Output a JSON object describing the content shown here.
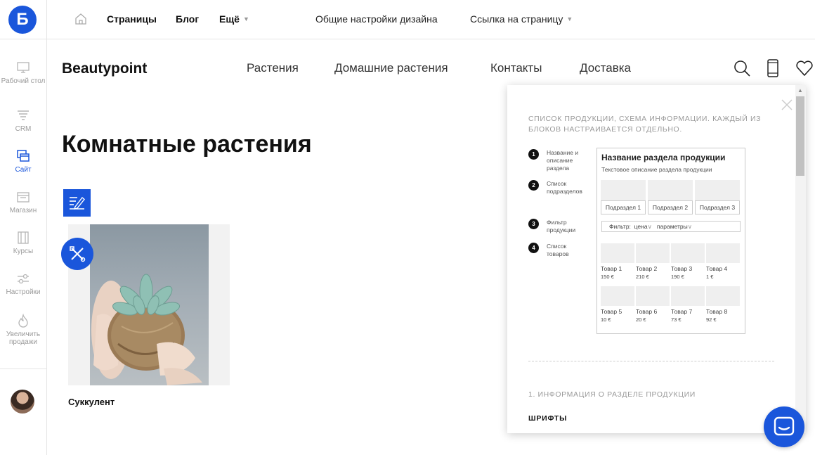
{
  "brand_color": "#1a56db",
  "app": {
    "logo_letter": "Б"
  },
  "sidebar": {
    "items": [
      {
        "label": "Рабочий стол",
        "icon": "monitor-icon"
      },
      {
        "label": "CRM",
        "icon": "funnel-icon"
      },
      {
        "label": "Сайт",
        "icon": "windows-icon",
        "active": true
      },
      {
        "label": "Магазин",
        "icon": "store-icon"
      },
      {
        "label": "Курсы",
        "icon": "book-icon"
      },
      {
        "label": "Настройки",
        "icon": "sliders-icon"
      },
      {
        "label": "Увеличить продажи",
        "icon": "flame-icon"
      }
    ]
  },
  "topbar": {
    "pages": "Страницы",
    "blog": "Блог",
    "more": "Ещё",
    "design_settings": "Общие настройки дизайна",
    "page_link": "Ссылка на страницу"
  },
  "site": {
    "brand": "Beautypoint",
    "nav": [
      "Растения",
      "Домашние растения",
      "Контакты",
      "Доставка"
    ],
    "title": "Комнатные растения",
    "product_name": "Суккулент"
  },
  "panel": {
    "description": "Список продукции, схема информации. Каждый из блоков настраивается отдельно.",
    "steps": [
      {
        "num": "1",
        "label": "Название и описание раздела"
      },
      {
        "num": "2",
        "label": "Список подразделов"
      },
      {
        "num": "3",
        "label": "Фильтр продукции"
      },
      {
        "num": "4",
        "label": "Список товаров"
      }
    ],
    "scheme": {
      "title": "Название раздела продукции",
      "subtitle": "Текстовое описание раздела продукции",
      "subsections": [
        "Подраздел 1",
        "Подраздел 2",
        "Подраздел 3"
      ],
      "filter_label": "Фильтр:",
      "filter_price": "цена",
      "filter_params": "параметры",
      "products": [
        {
          "name": "Товар 1",
          "price": "150 €"
        },
        {
          "name": "Товар 2",
          "price": "210 €"
        },
        {
          "name": "Товар 3",
          "price": "190 €"
        },
        {
          "name": "Товар 4",
          "price": "1 €"
        },
        {
          "name": "Товар 5",
          "price": "10 €"
        },
        {
          "name": "Товар 6",
          "price": "20 €"
        },
        {
          "name": "Товар 7",
          "price": "73 €"
        },
        {
          "name": "Товар 8",
          "price": "92 €"
        }
      ]
    },
    "section_title": "1. Информация о разделе продукции",
    "fonts_label": "ШРИФТЫ"
  }
}
